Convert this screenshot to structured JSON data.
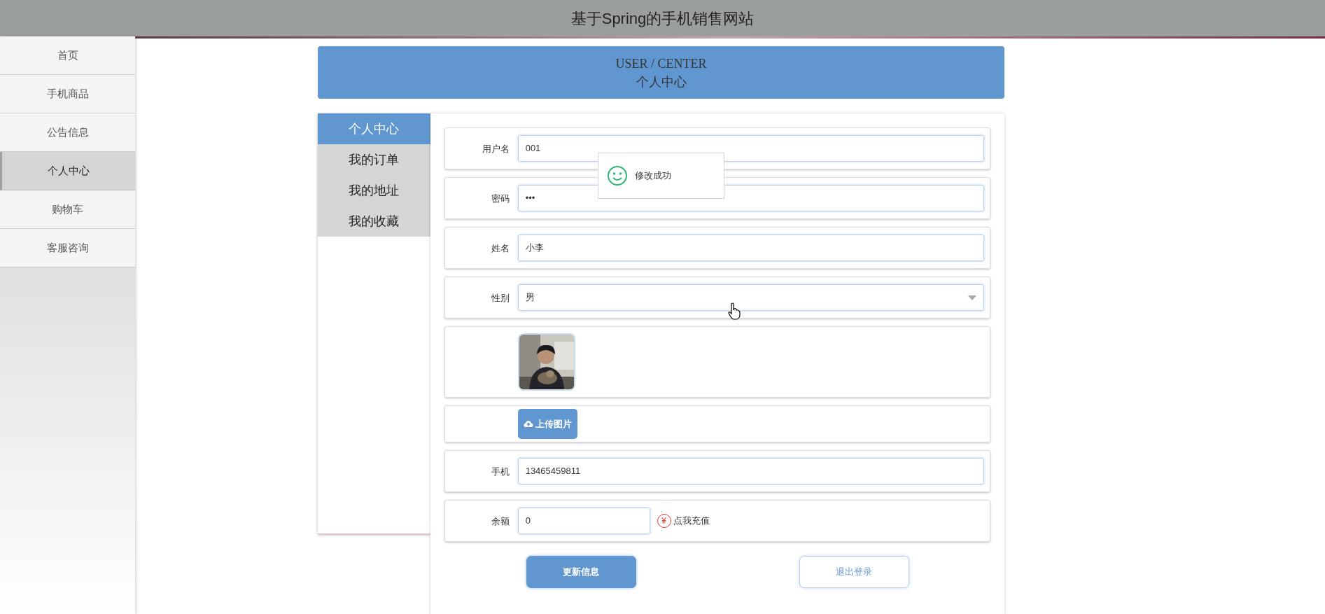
{
  "header": {
    "title": "基于Spring的手机销售网站"
  },
  "nav": [
    {
      "label": "首页",
      "selected": false
    },
    {
      "label": "手机商品",
      "selected": false
    },
    {
      "label": "公告信息",
      "selected": false
    },
    {
      "label": "个人中心",
      "selected": true
    },
    {
      "label": "购物车",
      "selected": false
    },
    {
      "label": "客服咨询",
      "selected": false
    }
  ],
  "banner": {
    "title": "USER / CENTER",
    "subtitle": "个人中心"
  },
  "menu": [
    {
      "label": "个人中心",
      "selected": true
    },
    {
      "label": "我的订单",
      "selected": false
    },
    {
      "label": "我的地址",
      "selected": false
    },
    {
      "label": "我的收藏",
      "selected": false
    }
  ],
  "form": {
    "fields": [
      {
        "kind": "text",
        "label": "用户名",
        "value": "001"
      },
      {
        "kind": "text",
        "label": "密码",
        "value": "•••"
      },
      {
        "kind": "text",
        "label": "姓名",
        "value": "小李"
      },
      {
        "kind": "select",
        "label": "性别",
        "value": "男"
      },
      {
        "kind": "avatar"
      },
      {
        "kind": "upload",
        "button": "上传图片"
      },
      {
        "kind": "text",
        "label": "手机",
        "value": "13465459811"
      },
      {
        "kind": "balance",
        "label": "余额",
        "value": "0",
        "link_icon": "¥",
        "link": "点我充值"
      }
    ]
  },
  "actions": [
    {
      "kind": "primary",
      "label": "更新信息"
    },
    {
      "kind": "outline",
      "label": "退出登录"
    }
  ],
  "toast": {
    "message": "修改成功"
  }
}
